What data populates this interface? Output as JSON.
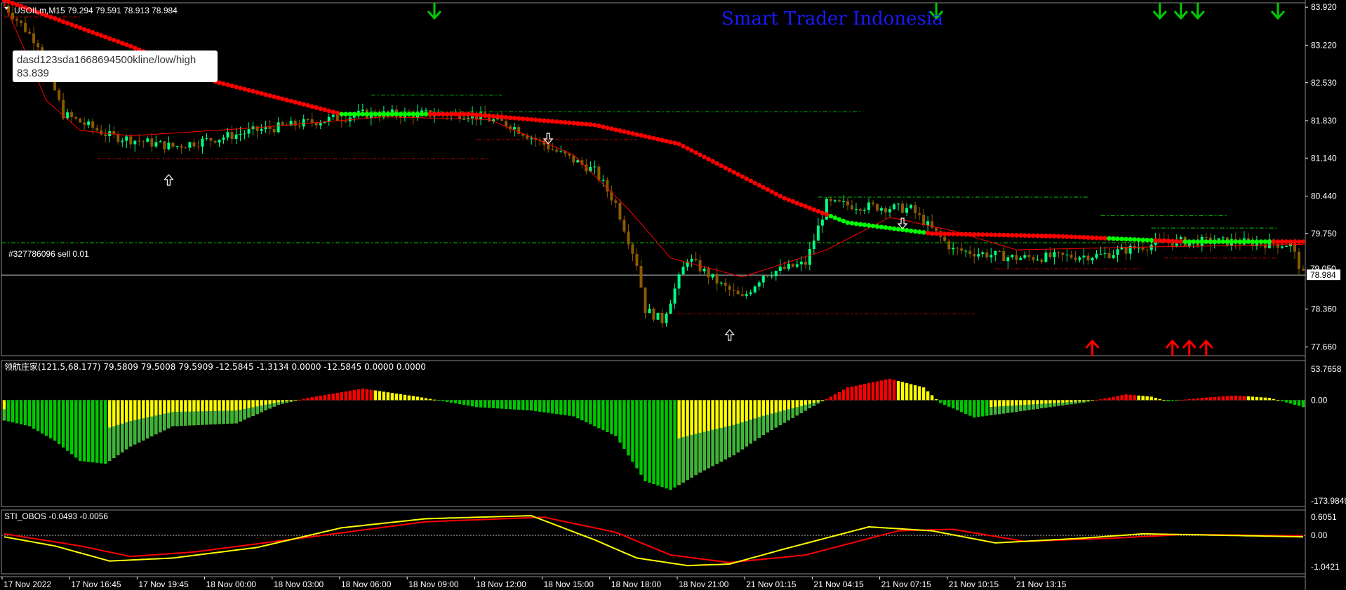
{
  "colors": {
    "background": "#000000",
    "grid_frame": "#8a8a8a",
    "bull_candle": "#00ff7f",
    "bear_candle": "#8b5a00",
    "ma_thin": "#ff0000",
    "dots_red": "#ff0000",
    "dots_green": "#00ff00",
    "level_green": "#00cc00",
    "level_red": "#cc0000",
    "hist_green": "#00c800",
    "hist_yellow": "#ffff00",
    "hist_red": "#ff0000",
    "osc_yellow": "#ffff00",
    "osc_red": "#ff0000",
    "watermark": "#1a1aff"
  },
  "header": {
    "symbol_info": "USOILm,M15  79.294 79.591 78.913 78.984",
    "watermark": "Smart Trader Indonesia"
  },
  "tooltip": {
    "line1": "dasd123sda1668694500kline/low/high",
    "line2": "83.839"
  },
  "order_label": "#327786096 sell 0.01",
  "current_price_label": "78.984",
  "hidden_price_label": "79.050",
  "indicator1": {
    "header": "领航庄家(121.5,68.177) 79.5809 79.5008 79.5909 -12.5845 -1.3134 0.0000 -12.5845 0.0000 0.0000",
    "axis_labels": [
      "53.7658",
      "0.00",
      "-173.9849"
    ]
  },
  "indicator2": {
    "header": "STI_OBOS -0.0493 -0.0056",
    "axis_labels": [
      "0.6051",
      "0.00",
      "-1.0421"
    ]
  },
  "chart_data": {
    "type": "candlestick",
    "symbol": "USOILm",
    "timeframe": "M15",
    "price_axis": {
      "ticks": [
        83.92,
        83.22,
        82.53,
        81.83,
        81.14,
        80.44,
        79.75,
        78.36,
        77.66
      ],
      "tick_labels": [
        "83.920",
        "83.220",
        "82.530",
        "81.830",
        "81.140",
        "80.440",
        "79.750",
        "78.360",
        "77.660"
      ],
      "range": [
        77.5,
        84.0
      ]
    },
    "time_axis_labels": [
      "17 Nov 2022",
      "17 Nov 16:45",
      "17 Nov 19:45",
      "18 Nov 00:00",
      "18 Nov 03:00",
      "18 Nov 06:00",
      "18 Nov 09:00",
      "18 Nov 12:00",
      "18 Nov 15:00",
      "18 Nov 18:00",
      "18 Nov 21:00",
      "21 Nov 01:15",
      "21 Nov 04:15",
      "21 Nov 07:15",
      "21 Nov 10:15",
      "21 Nov 13:15"
    ],
    "close_anchors": [
      [
        0,
        83.95
      ],
      [
        8,
        83.25
      ],
      [
        14,
        81.95
      ],
      [
        25,
        81.55
      ],
      [
        40,
        81.35
      ],
      [
        60,
        81.65
      ],
      [
        85,
        81.95
      ],
      [
        110,
        81.95
      ],
      [
        120,
        81.75
      ],
      [
        130,
        81.3
      ],
      [
        140,
        80.9
      ],
      [
        145,
        80.3
      ],
      [
        150,
        79.2
      ],
      [
        152,
        78.35
      ],
      [
        156,
        78.15
      ],
      [
        162,
        79.3
      ],
      [
        170,
        78.8
      ],
      [
        175,
        78.55
      ],
      [
        180,
        79.0
      ],
      [
        190,
        79.2
      ],
      [
        195,
        80.3
      ],
      [
        205,
        80.25
      ],
      [
        215,
        80.2
      ],
      [
        225,
        79.45
      ],
      [
        240,
        79.3
      ],
      [
        260,
        79.35
      ],
      [
        275,
        79.6
      ],
      [
        290,
        79.6
      ],
      [
        305,
        79.55
      ],
      [
        308,
        78.98
      ]
    ],
    "dots_anchors": [
      [
        0,
        84.05
      ],
      [
        30,
        83.2
      ],
      [
        50,
        82.55
      ],
      [
        70,
        82.15
      ],
      [
        80,
        81.95
      ],
      [
        110,
        81.95
      ],
      [
        140,
        81.75
      ],
      [
        160,
        81.4
      ],
      [
        185,
        80.4
      ],
      [
        200,
        79.95
      ],
      [
        220,
        79.75
      ],
      [
        250,
        79.7
      ],
      [
        280,
        79.6
      ],
      [
        308,
        79.6
      ]
    ],
    "dots_green_ranges": [
      [
        80,
        100
      ],
      [
        196,
        218
      ],
      [
        262,
        272
      ],
      [
        280,
        300
      ]
    ],
    "levels": [
      {
        "price": 83.74,
        "from": 0,
        "to": 18,
        "color": "red"
      },
      {
        "price": 81.13,
        "from": 22,
        "to": 115,
        "color": "red"
      },
      {
        "price": 82.3,
        "from": 87,
        "to": 118,
        "color": "green"
      },
      {
        "price": 81.99,
        "from": 87,
        "to": 203,
        "color": "green"
      },
      {
        "price": 81.48,
        "from": 112,
        "to": 150,
        "color": "red"
      },
      {
        "price": 78.27,
        "from": 155,
        "to": 230,
        "color": "red"
      },
      {
        "price": 80.42,
        "from": 193,
        "to": 257,
        "color": "green"
      },
      {
        "price": 80.08,
        "from": 260,
        "to": 290,
        "color": "green"
      },
      {
        "price": 79.1,
        "from": 235,
        "to": 270,
        "color": "red"
      },
      {
        "price": 79.85,
        "from": 272,
        "to": 302,
        "color": "green"
      },
      {
        "price": 79.3,
        "from": 275,
        "to": 302,
        "color": "red"
      }
    ],
    "order_line_price": 79.58,
    "current_price": 78.984,
    "arrows_down_bars": [
      102,
      221,
      274,
      279,
      283,
      302
    ],
    "arrows_up_bars": [
      258,
      277,
      281,
      285
    ],
    "hollow_up_arrow_bars": [
      39,
      172
    ],
    "hollow_down_arrow_bars": [
      129,
      213
    ],
    "indicator1_anchors": [
      [
        0,
        -35
      ],
      [
        6,
        -45
      ],
      [
        12,
        -70
      ],
      [
        18,
        -105
      ],
      [
        24,
        -110
      ],
      [
        30,
        -80
      ],
      [
        40,
        -45
      ],
      [
        55,
        -40
      ],
      [
        65,
        -8
      ],
      [
        72,
        4
      ],
      [
        85,
        20
      ],
      [
        98,
        6
      ],
      [
        112,
        -12
      ],
      [
        125,
        -18
      ],
      [
        135,
        -28
      ],
      [
        145,
        -62
      ],
      [
        152,
        -140
      ],
      [
        158,
        -155
      ],
      [
        165,
        -125
      ],
      [
        173,
        -95
      ],
      [
        180,
        -60
      ],
      [
        190,
        -18
      ],
      [
        200,
        22
      ],
      [
        210,
        37
      ],
      [
        218,
        22
      ],
      [
        222,
        -5
      ],
      [
        230,
        -30
      ],
      [
        240,
        -20
      ],
      [
        256,
        -4
      ],
      [
        266,
        10
      ],
      [
        272,
        6
      ],
      [
        276,
        -2
      ],
      [
        284,
        4
      ],
      [
        292,
        8
      ],
      [
        300,
        4
      ],
      [
        308,
        -12
      ]
    ],
    "indicator2_yellow_anchors": [
      [
        0,
        -0.05
      ],
      [
        12,
        -0.35
      ],
      [
        25,
        -0.85
      ],
      [
        40,
        -0.75
      ],
      [
        60,
        -0.4
      ],
      [
        80,
        0.25
      ],
      [
        100,
        0.55
      ],
      [
        125,
        0.65
      ],
      [
        140,
        -0.15
      ],
      [
        150,
        -0.75
      ],
      [
        162,
        -1.0
      ],
      [
        172,
        -0.95
      ],
      [
        185,
        -0.45
      ],
      [
        205,
        0.28
      ],
      [
        220,
        0.15
      ],
      [
        235,
        -0.25
      ],
      [
        255,
        -0.1
      ],
      [
        270,
        0.05
      ],
      [
        290,
        0.0
      ],
      [
        308,
        -0.05
      ]
    ],
    "indicator2_red_anchors": [
      [
        0,
        0.05
      ],
      [
        18,
        -0.35
      ],
      [
        30,
        -0.7
      ],
      [
        45,
        -0.55
      ],
      [
        70,
        -0.1
      ],
      [
        100,
        0.45
      ],
      [
        128,
        0.6
      ],
      [
        145,
        0.1
      ],
      [
        158,
        -0.65
      ],
      [
        172,
        -0.9
      ],
      [
        190,
        -0.65
      ],
      [
        212,
        0.15
      ],
      [
        225,
        0.2
      ],
      [
        242,
        -0.2
      ],
      [
        262,
        -0.1
      ],
      [
        280,
        0.03
      ],
      [
        308,
        -0.02
      ]
    ]
  }
}
